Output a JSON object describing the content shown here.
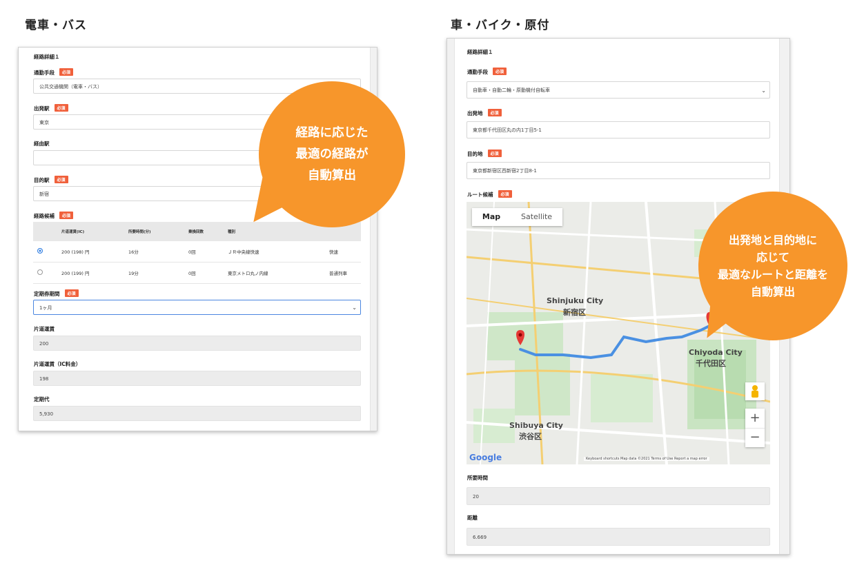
{
  "left": {
    "title": "電車・バス",
    "section": "経路詳細１",
    "commute_label": "通勤手段",
    "required": "必須",
    "commute_value": "公共交通機関（電車・バス）",
    "depart_label": "出発駅",
    "depart_value": "東京",
    "via_label": "経由駅",
    "via_value": "",
    "dest_label": "目的駅",
    "dest_value": "新宿",
    "candidates_label": "経路候補",
    "table_headers": [
      "片道運賃(IC)",
      "所要時間(分)",
      "乗換回数",
      "種別"
    ],
    "rows": [
      {
        "fare": "200 (198) 円",
        "time": "16分",
        "transfers": "0回",
        "line": "ＪＲ中央線快速",
        "kind": "快速"
      },
      {
        "fare": "200 (199) 円",
        "time": "19分",
        "transfers": "0回",
        "line": "東京メトロ丸ノ内線",
        "kind": "普通列車"
      }
    ],
    "period_label": "定期券期間",
    "period_value": "1ヶ月",
    "oneway_label": "片道運賃",
    "oneway_value": "200",
    "oneway_ic_label": "片道運賃（IC料金）",
    "oneway_ic_value": "198",
    "pass_label": "定期代",
    "pass_value": "5,930"
  },
  "left_bubble": {
    "lines": [
      "経路に応じた",
      "最適の経路が",
      "自動算出"
    ]
  },
  "right": {
    "title": "車・バイク・原付",
    "section": "経路詳細１",
    "commute_label": "通勤手段",
    "required": "必須",
    "commute_value": "自動車・自動二輪・原動機付自転車",
    "depart_label": "出発地",
    "depart_value": "東京都千代田区丸の内1丁目5-1",
    "dest_label": "目的地",
    "dest_value": "東京都新宿区西新宿2丁目8-1",
    "route_label": "ルート候補",
    "time_label": "所要時間",
    "time_value": "20",
    "distance_label": "距離",
    "distance_value": "6.669"
  },
  "right_bubble": {
    "lines": [
      "出発地と目的地に",
      "応じて",
      "最適なルートと距離を",
      "自動算出"
    ]
  },
  "map": {
    "tab_map": "Map",
    "tab_satellite": "Satellite",
    "shinjuku_en": "Shinjuku City",
    "shinjuku_jp": "新宿区",
    "chiyoda_en": "Chiyoda City",
    "chiyoda_jp": "千代田区",
    "shibuya_en": "Shibuya City",
    "shibuya_jp": "渋谷区",
    "zoom_in": "+",
    "zoom_out": "−",
    "google": "Google",
    "footer": "Keyboard shortcuts   Map data ©2021   Terms of Use   Report a map error",
    "route_color": "#4a90e2",
    "pin_color": "#e53935"
  },
  "colors": {
    "accent": "#f7962b",
    "required": "#f0603b"
  }
}
